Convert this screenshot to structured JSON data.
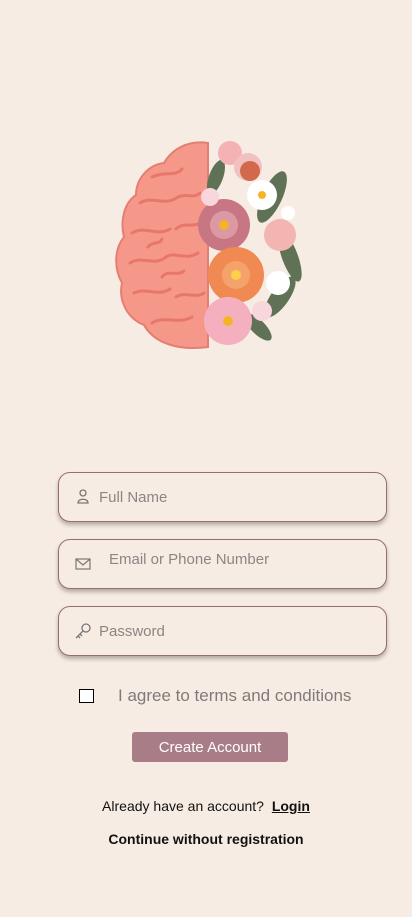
{
  "hero": {
    "icon": "brain-flowers-illustration"
  },
  "form": {
    "full_name": {
      "placeholder": "Full Name",
      "icon": "person-icon"
    },
    "email": {
      "placeholder": "Email or Phone Number",
      "icon": "mail-icon"
    },
    "password": {
      "placeholder": "Password",
      "icon": "key-icon"
    }
  },
  "terms": {
    "label": "I agree to terms and conditions",
    "checked": false
  },
  "create_account": {
    "label": "Create Account"
  },
  "login": {
    "prompt": "Already have an account?",
    "link": "Login"
  },
  "continue_label": "Continue without registration",
  "colors": {
    "background": "#F7ECE4",
    "button": "#A97D88",
    "field_border": "#9A6B6F",
    "brain": "#F5988A"
  }
}
